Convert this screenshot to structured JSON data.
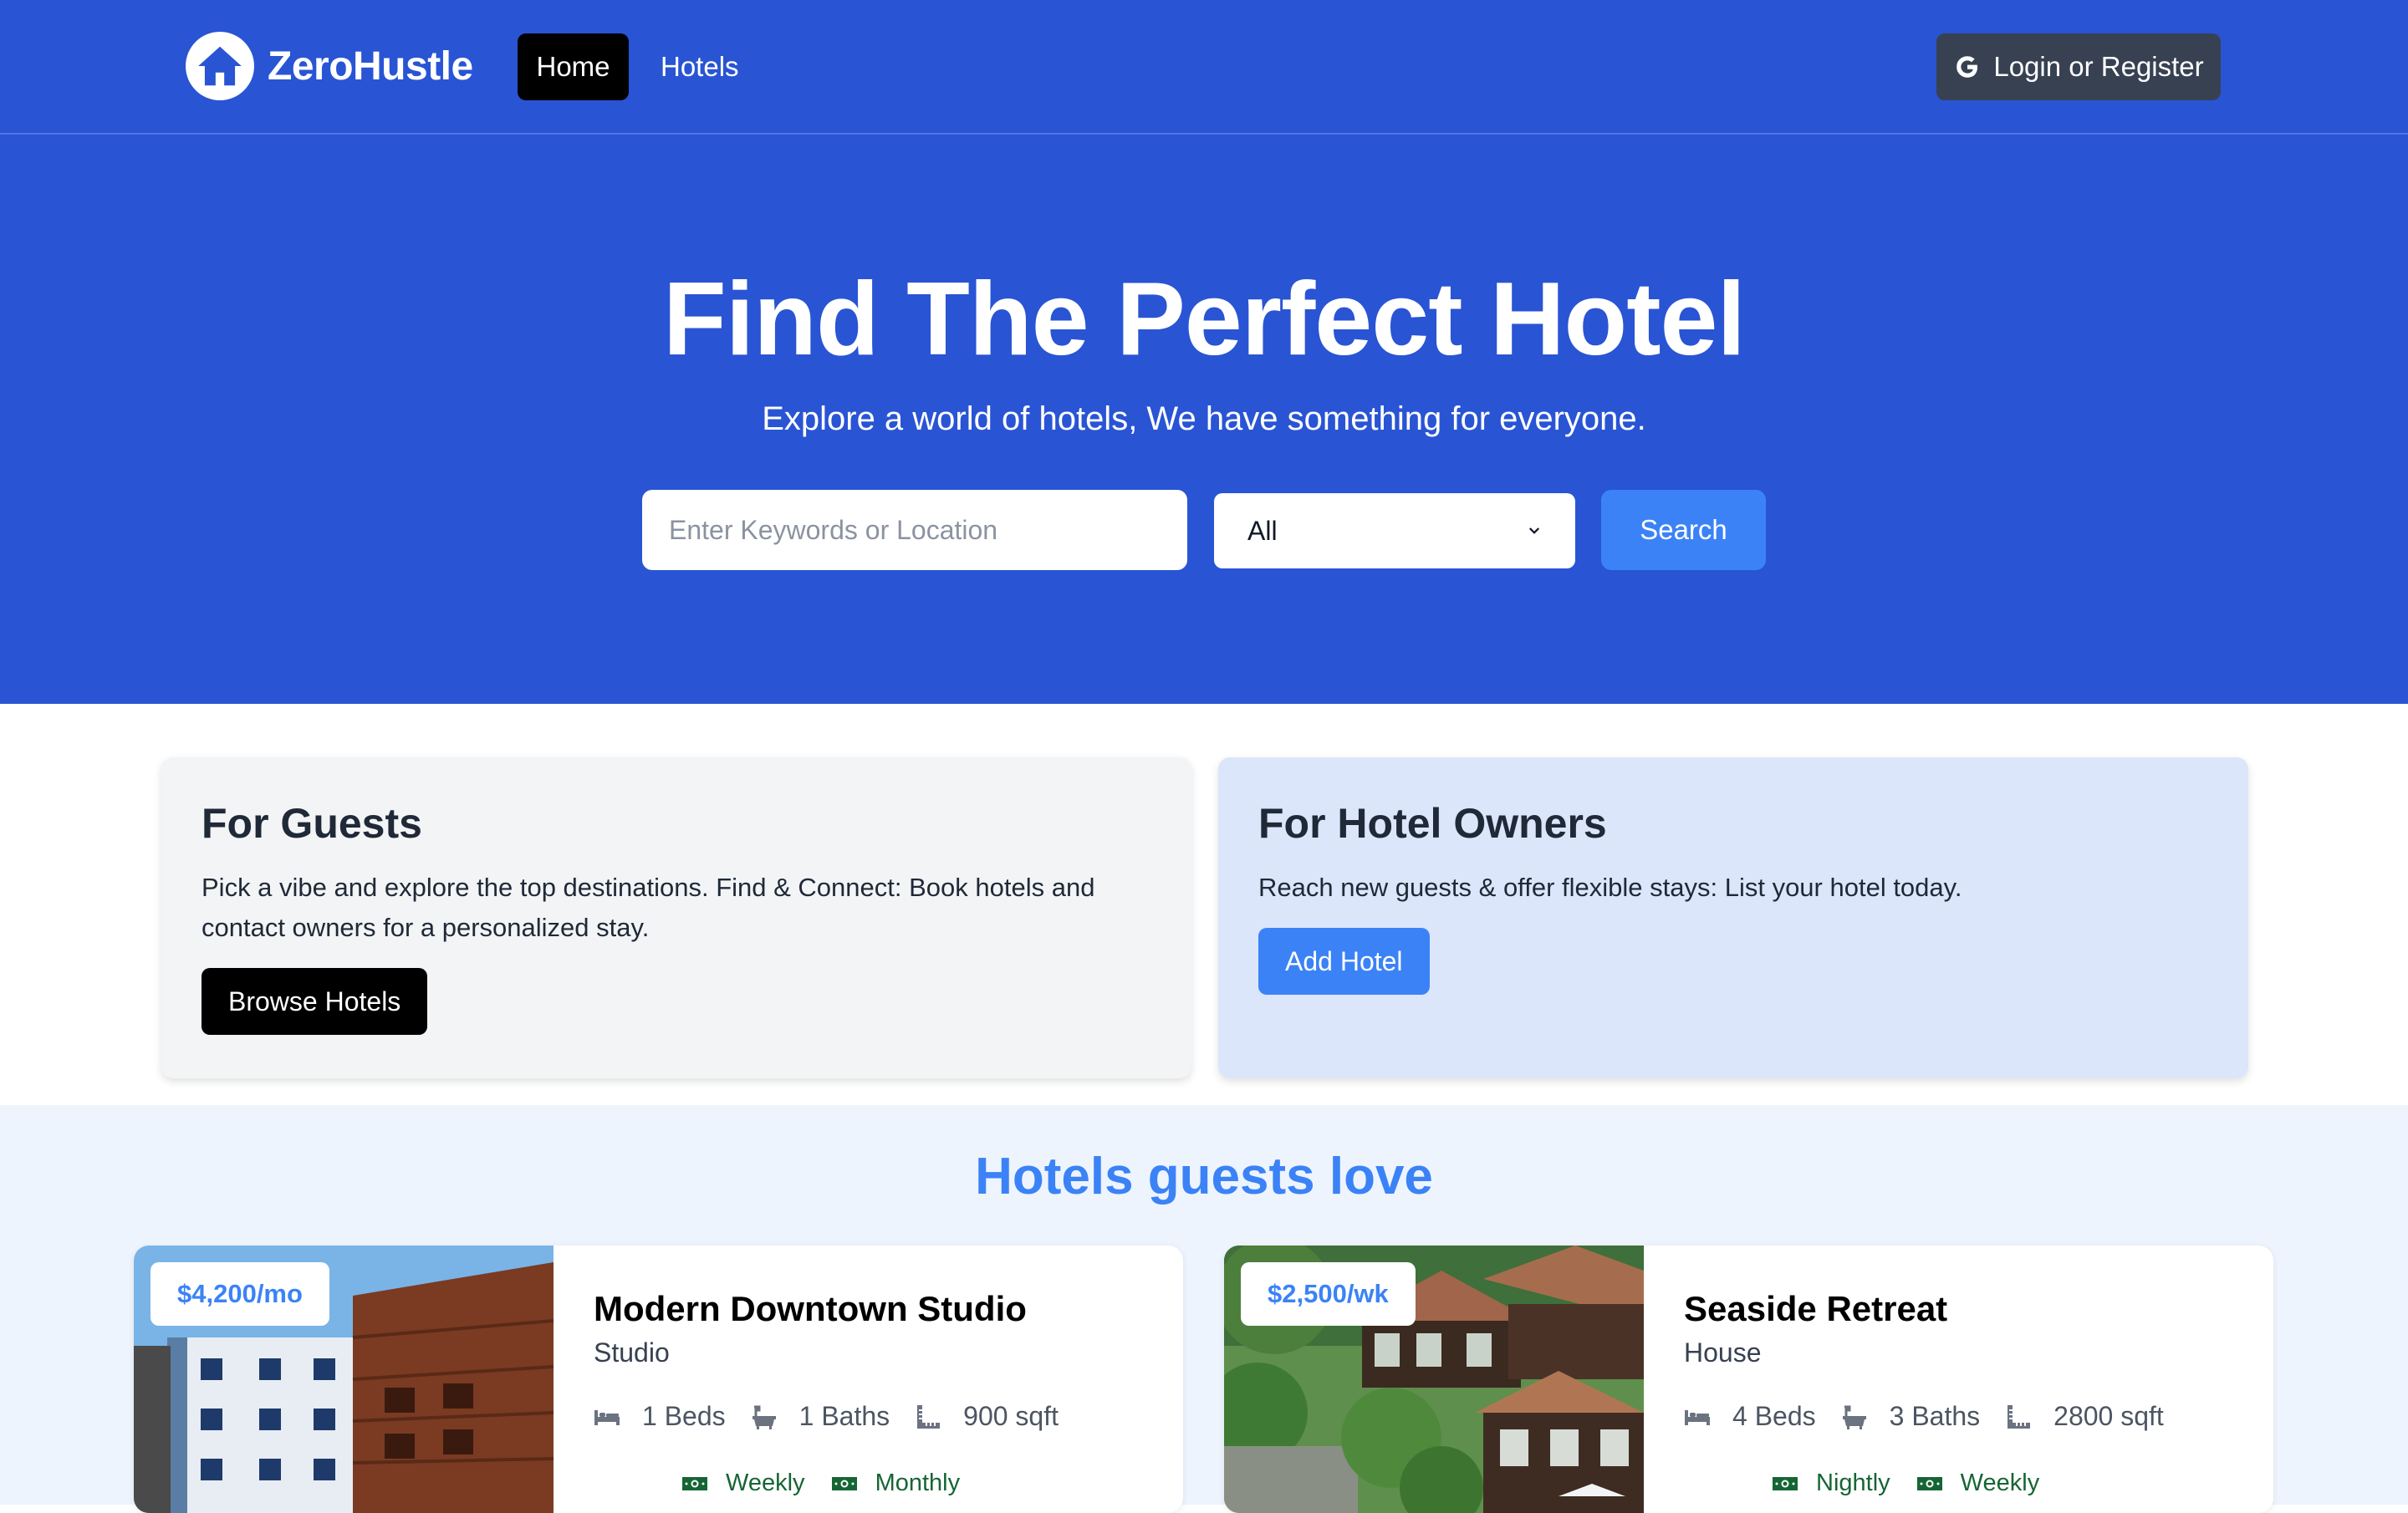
{
  "nav": {
    "brand": "ZeroHustle",
    "links": [
      "Home",
      "Hotels"
    ],
    "login": "Login or Register"
  },
  "hero": {
    "title": "Find The Perfect Hotel",
    "subtitle": "Explore a world of hotels, We have something for everyone.",
    "search_placeholder": "Enter Keywords or Location",
    "search_value": "",
    "type_selected": "All",
    "search_button": "Search"
  },
  "info": {
    "guests": {
      "title": "For Guests",
      "text": "Pick a vibe and explore the top destinations. Find & Connect: Book hotels and contact owners for a personalized stay.",
      "button": "Browse Hotels"
    },
    "owners": {
      "title": "For Hotel Owners",
      "text": "Reach new guests & offer flexible stays: List your hotel today.",
      "button": "Add Hotel"
    }
  },
  "featured": {
    "title": "Hotels guests love",
    "hotels": [
      {
        "price": "$4,200/mo",
        "name": "Modern Downtown Studio",
        "type": "Studio",
        "beds": "1 Beds",
        "baths": "1 Baths",
        "sqft": "900 sqft",
        "rates": [
          "Weekly",
          "Monthly"
        ]
      },
      {
        "price": "$2,500/wk",
        "name": "Seaside Retreat",
        "type": "House",
        "beds": "4 Beds",
        "baths": "3 Baths",
        "sqft": "2800 sqft",
        "rates": [
          "Nightly",
          "Weekly"
        ]
      }
    ]
  },
  "colors": {
    "brand_blue": "#2954d4",
    "accent_blue": "#3b82f6",
    "rate_green": "#166534"
  },
  "icons": {
    "logo": "house-icon",
    "login": "google-icon",
    "beds": "bed-icon",
    "baths": "bath-icon",
    "sqft": "ruler-icon",
    "rate": "money-bill-icon",
    "select": "chevron-down-icon"
  }
}
